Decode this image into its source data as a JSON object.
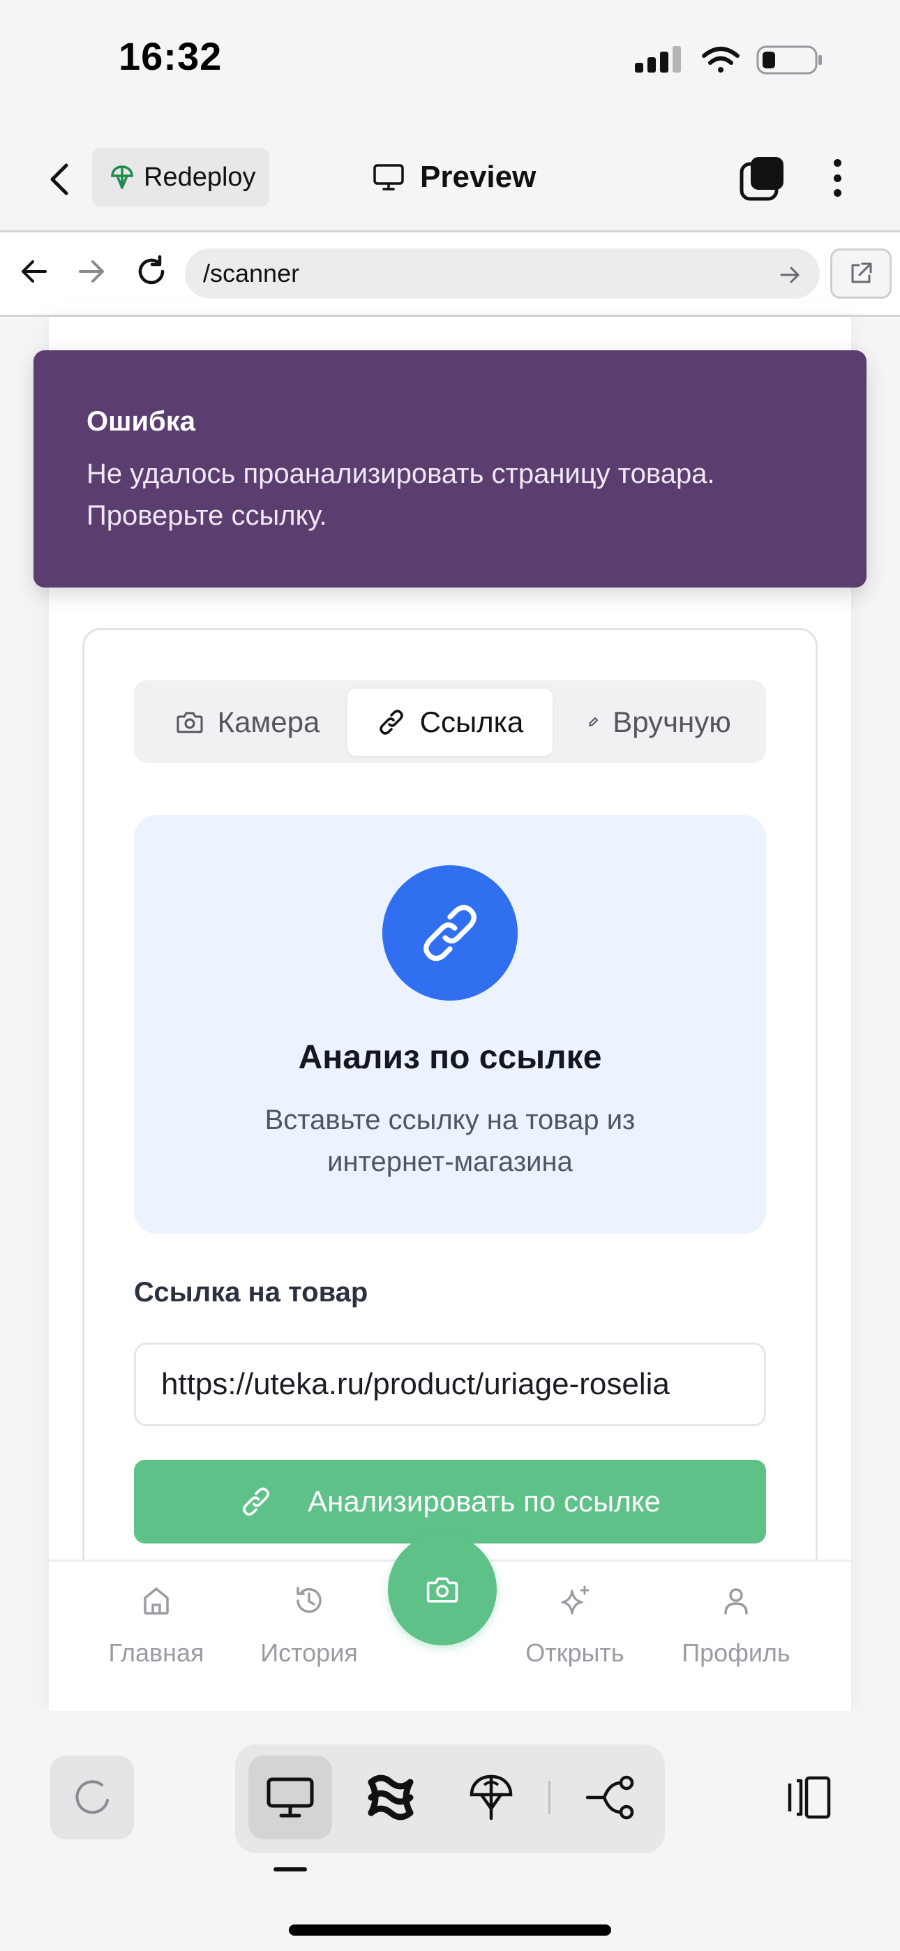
{
  "status_bar": {
    "time": "16:32"
  },
  "app_bar": {
    "redeploy_label": "Redeploy",
    "title": "Preview"
  },
  "browser": {
    "url": "/scanner"
  },
  "toast": {
    "title": "Ошибка",
    "message": "Не удалось проанализировать страницу товара. Проверьте ссылку."
  },
  "tabs": [
    {
      "label": "Камера",
      "icon": "camera-icon"
    },
    {
      "label": "Ссылка",
      "icon": "link-icon",
      "active": true
    },
    {
      "label": "Вручную",
      "icon": "pen-icon"
    }
  ],
  "hero": {
    "icon": "link-icon",
    "title": "Анализ по ссылке",
    "description": "Вставьте ссылку на товар из интернет-магазина"
  },
  "form": {
    "label": "Ссылка на товар",
    "value": "https://uteka.ru/product/uriage-roselia",
    "submit_label": "Анализировать по ссылке"
  },
  "bottom_nav": [
    {
      "label": "Главная",
      "icon": "home-icon"
    },
    {
      "label": "История",
      "icon": "history-icon"
    },
    {
      "label": "Открыть",
      "icon": "sparkle-icon"
    },
    {
      "label": "Профиль",
      "icon": "user-icon"
    }
  ],
  "colors": {
    "toast_bg": "#5b3d6f",
    "accent_blue": "#2f6ff0",
    "accent_green": "#5ec188",
    "hero_bg": "#edf3fe"
  }
}
